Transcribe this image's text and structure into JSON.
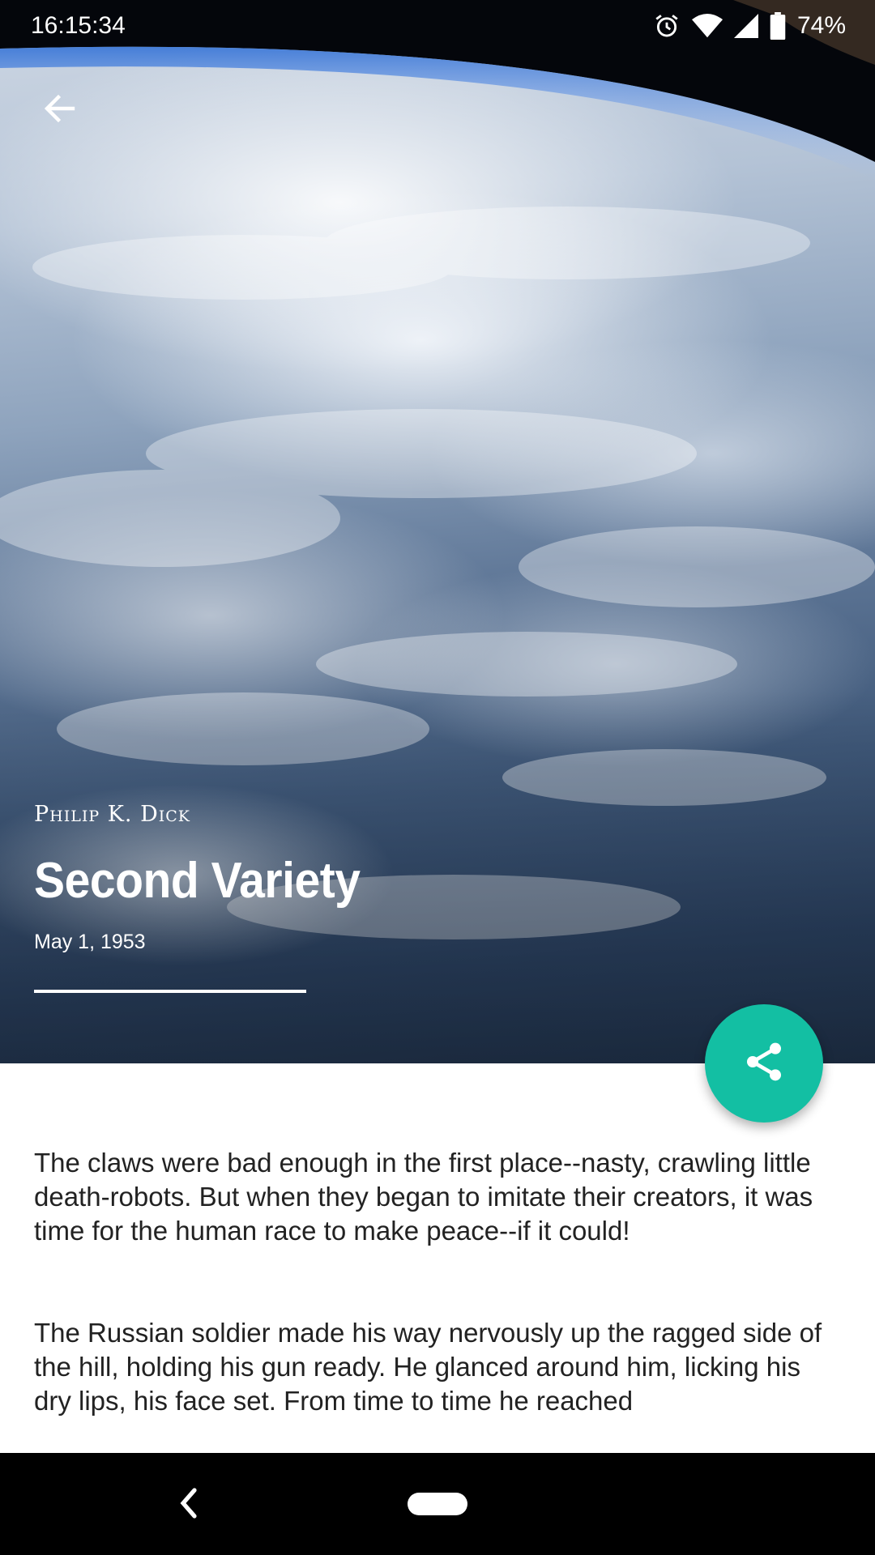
{
  "status_bar": {
    "time": "16:15:34",
    "battery": "74%",
    "icons": [
      "alarm-icon",
      "wifi-icon",
      "signal-icon",
      "battery-icon"
    ]
  },
  "header": {
    "back_icon": "arrow-left-icon"
  },
  "article": {
    "author": "Philip K. Dick",
    "title": "Second Variety",
    "date": "May 1, 1953",
    "paragraphs": [
      "The claws were bad enough in the first place--nasty, crawling little death-robots. But when they began to imitate their creators, it was time for the human race to make peace--if it could!",
      "The Russian soldier made his way nervously up the ragged side of the hill, holding his gun ready. He glanced around him, licking his dry lips, his face set. From time to time he reached"
    ]
  },
  "fab": {
    "icon": "share-icon",
    "color": "#13bfa3"
  },
  "navigation": {
    "back_icon": "nav-back-icon",
    "home_icon": "nav-home-pill"
  }
}
